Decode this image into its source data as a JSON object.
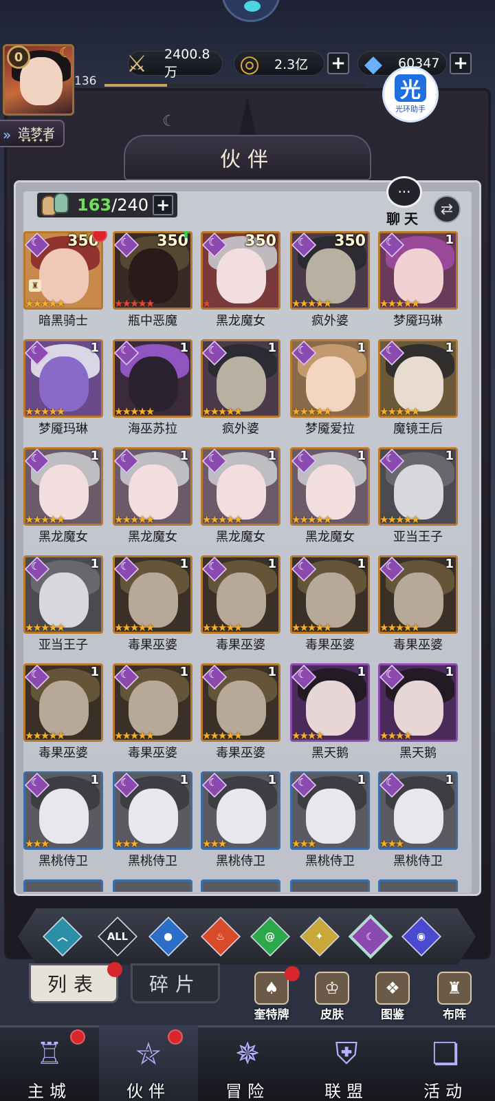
{
  "colors": {
    "gold_border": "#b87a2a",
    "purple_border": "#8a4ab0",
    "blue_border": "#3a6ea8",
    "count_green": "#6ee05a",
    "red_dot": "#d8262c"
  },
  "player": {
    "level_badge": "0",
    "level": "136",
    "title": "造梦者",
    "xp_fraction": 0.24
  },
  "resources": {
    "power": "2400.8万",
    "gold": "2.3亿",
    "diamonds": "60347"
  },
  "helper": {
    "logo": "光",
    "label": "光环助手"
  },
  "header": {
    "title": "伙伴"
  },
  "roster": {
    "owned": "163",
    "capacity": "/240",
    "plus": "+"
  },
  "chat": {
    "label": "聊天",
    "glyph": "···"
  },
  "swap": {
    "glyph": "⇄"
  },
  "cards": [
    {
      "name": "暗黑骑士",
      "level": "350",
      "stars": "★★★★★",
      "star_color": "gold",
      "frame": "gold",
      "red_dot": true,
      "lock": true,
      "face": "#f0c8b8",
      "hair": "#8a2a2a",
      "bg": "#c78a4a"
    },
    {
      "name": "瓶中恶魔",
      "level": "350",
      "stars": "★★★★★",
      "star_color": "red",
      "frame": "gold",
      "up_arrow": true,
      "face": "#2a1a1a",
      "hair": "#5a4a34",
      "bg": "#3a2a26"
    },
    {
      "name": "黑龙魔女",
      "level": "350",
      "stars": "★",
      "star_color": "red",
      "frame": "gold",
      "face": "#f2dede",
      "hair": "#c8c8cc",
      "bg": "#7a3a3a"
    },
    {
      "name": "疯外婆",
      "level": "350",
      "stars": "★★★★★",
      "star_color": "gold",
      "frame": "gold",
      "face": "#b8b0a0",
      "hair": "#2a2a30",
      "bg": "#4a3a4a"
    },
    {
      "name": "梦魇玛琳",
      "level": "1",
      "stars": "★★★★★",
      "star_color": "gold",
      "frame": "gold",
      "face": "#f0d2d2",
      "hair": "#a04aa0",
      "bg": "#6a3a5a"
    },
    {
      "name": "梦魇玛琳",
      "level": "1",
      "stars": "★★★★★",
      "star_color": "gold",
      "frame": "gold",
      "face": "#8a6ac8",
      "hair": "#e6e6ee",
      "bg": "#6a4a8a"
    },
    {
      "name": "海巫苏拉",
      "level": "1",
      "stars": "★★★★★",
      "star_color": "gold",
      "frame": "gold",
      "face": "#2a2230",
      "hair": "#9a5ad0",
      "bg": "#3a2a3a"
    },
    {
      "name": "疯外婆",
      "level": "1",
      "stars": "★★★★★",
      "star_color": "gold",
      "frame": "gold",
      "face": "#b8b0a0",
      "hair": "#2a2a30",
      "bg": "#4a3a4a"
    },
    {
      "name": "梦魇爱拉",
      "level": "1",
      "stars": "★★★★★",
      "star_color": "gold",
      "frame": "gold",
      "face": "#f2d6c2",
      "hair": "#c8a070",
      "bg": "#8a6a4a"
    },
    {
      "name": "魔镜王后",
      "level": "1",
      "stars": "★★★★★",
      "star_color": "gold",
      "frame": "gold",
      "face": "#e8dcd0",
      "hair": "#2a2a2e",
      "bg": "#6a5a3a"
    },
    {
      "name": "黑龙魔女",
      "level": "1",
      "stars": "★★★★★",
      "star_color": "gold",
      "frame": "gold",
      "face": "#f2dede",
      "hair": "#c8c8cc",
      "bg": "#6a5a6a"
    },
    {
      "name": "黑龙魔女",
      "level": "1",
      "stars": "★★★★★",
      "star_color": "gold",
      "frame": "gold",
      "face": "#f2dede",
      "hair": "#c8c8cc",
      "bg": "#6a5a6a"
    },
    {
      "name": "黑龙魔女",
      "level": "1",
      "stars": "★★★★★",
      "star_color": "gold",
      "frame": "gold",
      "face": "#f2dede",
      "hair": "#c8c8cc",
      "bg": "#6a5a6a"
    },
    {
      "name": "黑龙魔女",
      "level": "1",
      "stars": "★★★★★",
      "star_color": "gold",
      "frame": "gold",
      "face": "#f2dede",
      "hair": "#c8c8cc",
      "bg": "#6a5a6a"
    },
    {
      "name": "亚当王子",
      "level": "1",
      "stars": "★★★★★",
      "star_color": "gold",
      "frame": "gold",
      "face": "#d8d8dc",
      "hair": "#6a6a70",
      "bg": "#4a4a50"
    },
    {
      "name": "亚当王子",
      "level": "1",
      "stars": "★★★★★",
      "star_color": "gold",
      "frame": "gold",
      "face": "#d8d8dc",
      "hair": "#6a6a70",
      "bg": "#4a4a50"
    },
    {
      "name": "毒果巫婆",
      "level": "1",
      "stars": "★★★★★",
      "star_color": "gold",
      "frame": "gold",
      "face": "#b8a898",
      "hair": "#6a5a3a",
      "bg": "#3a3028"
    },
    {
      "name": "毒果巫婆",
      "level": "1",
      "stars": "★★★★★",
      "star_color": "gold",
      "frame": "gold",
      "face": "#b8a898",
      "hair": "#6a5a3a",
      "bg": "#3a3028"
    },
    {
      "name": "毒果巫婆",
      "level": "1",
      "stars": "★★★★★",
      "star_color": "gold",
      "frame": "gold",
      "face": "#b8a898",
      "hair": "#6a5a3a",
      "bg": "#3a3028"
    },
    {
      "name": "毒果巫婆",
      "level": "1",
      "stars": "★★★★★",
      "star_color": "gold",
      "frame": "gold",
      "face": "#b8a898",
      "hair": "#6a5a3a",
      "bg": "#3a3028"
    },
    {
      "name": "毒果巫婆",
      "level": "1",
      "stars": "★★★★★",
      "star_color": "gold",
      "frame": "gold",
      "face": "#b8a898",
      "hair": "#6a5a3a",
      "bg": "#3a3028"
    },
    {
      "name": "毒果巫婆",
      "level": "1",
      "stars": "★★★★★",
      "star_color": "gold",
      "frame": "gold",
      "face": "#b8a898",
      "hair": "#6a5a3a",
      "bg": "#3a3028"
    },
    {
      "name": "毒果巫婆",
      "level": "1",
      "stars": "★★★★★",
      "star_color": "gold",
      "frame": "gold",
      "face": "#b8a898",
      "hair": "#6a5a3a",
      "bg": "#3a3028"
    },
    {
      "name": "黑天鹅",
      "level": "1",
      "stars": "★★★★",
      "star_color": "gold",
      "frame": "purple",
      "face": "#e8d6d6",
      "hair": "#1e1a1e",
      "bg": "#4a2a5a"
    },
    {
      "name": "黑天鹅",
      "level": "1",
      "stars": "★★★★",
      "star_color": "gold",
      "frame": "purple",
      "face": "#e8d6d6",
      "hair": "#1e1a1e",
      "bg": "#4a2a5a"
    },
    {
      "name": "黑桃侍卫",
      "level": "1",
      "stars": "★★★",
      "star_color": "gold",
      "frame": "blue",
      "face": "#e8e8ec",
      "hair": "#3a3a40",
      "bg": "#5a5a62"
    },
    {
      "name": "黑桃侍卫",
      "level": "1",
      "stars": "★★★",
      "star_color": "gold",
      "frame": "blue",
      "face": "#e8e8ec",
      "hair": "#3a3a40",
      "bg": "#5a5a62"
    },
    {
      "name": "黑桃侍卫",
      "level": "1",
      "stars": "★★★",
      "star_color": "gold",
      "frame": "blue",
      "face": "#e8e8ec",
      "hair": "#3a3a40",
      "bg": "#5a5a62"
    },
    {
      "name": "黑桃侍卫",
      "level": "1",
      "stars": "★★★",
      "star_color": "gold",
      "frame": "blue",
      "face": "#e8e8ec",
      "hair": "#3a3a40",
      "bg": "#5a5a62"
    },
    {
      "name": "黑桃侍卫",
      "level": "1",
      "stars": "★★★",
      "star_color": "gold",
      "frame": "blue",
      "face": "#e8e8ec",
      "hair": "#3a3a40",
      "bg": "#5a5a62"
    }
  ],
  "filters": [
    {
      "icon": "chevron-up-icon",
      "glyph": "︿",
      "color": "#2c8fa8"
    },
    {
      "icon": "all-icon",
      "glyph": "ALL",
      "color": "#2a2c36"
    },
    {
      "icon": "water-drop-icon",
      "glyph": "●",
      "color": "#2a6ec8"
    },
    {
      "icon": "fire-icon",
      "glyph": "♨",
      "color": "#d84a2a"
    },
    {
      "icon": "wind-icon",
      "glyph": "@",
      "color": "#2aa84a"
    },
    {
      "icon": "light-icon",
      "glyph": "✦",
      "color": "#c8a838"
    },
    {
      "icon": "moon-icon",
      "glyph": "☾",
      "color": "#8a4ab0"
    },
    {
      "icon": "planet-icon",
      "glyph": "◉",
      "color": "#4a4ad0"
    }
  ],
  "tabs": {
    "list": "列表",
    "fragments": "碎片"
  },
  "side_buttons": [
    {
      "label": "奎特牌",
      "icon": "card-deck-icon",
      "glyph": "♠"
    },
    {
      "label": "皮肤",
      "icon": "skin-icon",
      "glyph": "♔"
    },
    {
      "label": "图鉴",
      "icon": "codex-icon",
      "glyph": "❖"
    },
    {
      "label": "布阵",
      "icon": "formation-icon",
      "glyph": "♜"
    }
  ],
  "nav": [
    {
      "label": "主城",
      "icon": "castle-icon",
      "glyph": "♖",
      "active": false,
      "red_dot": true
    },
    {
      "label": "伙伴",
      "icon": "witch-hat-icon",
      "glyph": "⛥",
      "active": true,
      "red_dot": true
    },
    {
      "label": "冒险",
      "icon": "compass-icon",
      "glyph": "✵",
      "active": false,
      "red_dot": false
    },
    {
      "label": "联盟",
      "icon": "shield-icon",
      "glyph": "⛨",
      "active": false,
      "red_dot": false
    },
    {
      "label": "活动",
      "icon": "cards-icon",
      "glyph": "❏",
      "active": false,
      "red_dot": false
    }
  ]
}
